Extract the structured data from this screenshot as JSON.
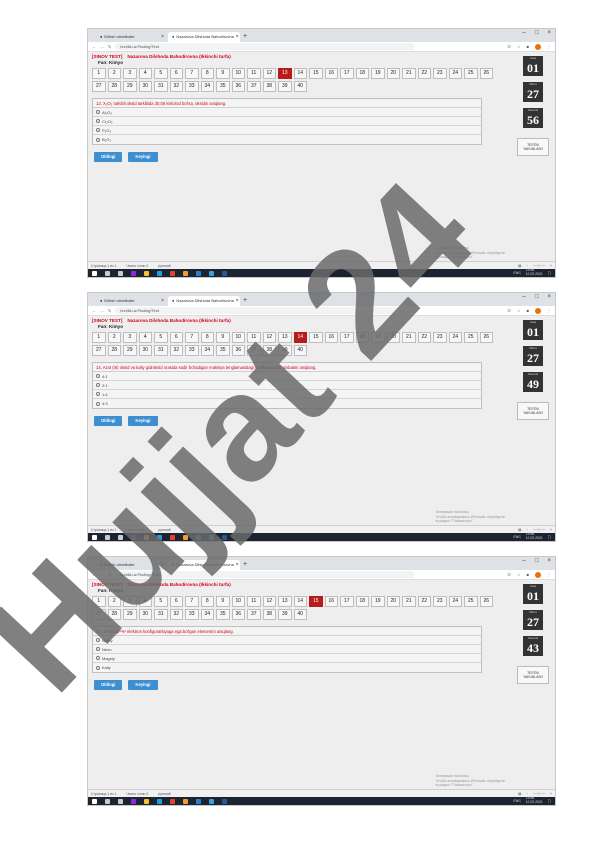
{
  "shots": [
    {
      "tab1": "Eritish viewfinder",
      "tab2": "Nazarova Dilshoda Bahodirovna",
      "url": "tezt48.uz/Testing/Test",
      "test_label": "[SINOV TEST]",
      "student": "Nazarova Dilshoda Bahodirovna (Ikkinchi turfa)",
      "fan": "Fan: Kimyo",
      "current": 13,
      "question": "13.   X₂O₃ tarkibli oksid tarkibida 30,06 kislorod bo'lsa, oksidni aniqlang.",
      "options": [
        "Al₂O₃",
        "Cr₂O₃",
        "P₂O₃",
        "B₂O₃"
      ],
      "timer": [
        "01",
        "27",
        "56"
      ]
    },
    {
      "tab1": "Eritish viewfinder",
      "tab2": "Nazarova Dilshoda Bahodirovna",
      "url": "tezt48.uz/Testing/Test",
      "test_label": "[SINOV TEST]",
      "student": "Nazarova Dilshoda Bahodirovna (Ikkinchi turfa)",
      "fan": "Fan: Kimyo",
      "current": 14,
      "question": "14.   Azot (III) oksid va kaliy gidroksid orasida sodir bo'ladigan reaksiya tenglamasidagi koeffitsiyentlar nisbatini aniqlang.",
      "options": [
        "4:1",
        "2:1",
        "1:4",
        "4:3"
      ],
      "timer": [
        "01",
        "27",
        "49"
      ]
    },
    {
      "tab1": "Eritish viewfinder",
      "tab2": "Nazarova Dilshoda Bahodirovna",
      "url": "tezt48.uz/Testing/Test",
      "test_label": "[SINOV TEST]",
      "student": "Nazarova Dilshoda Bahodirovna (Ikkinchi turfa)",
      "fan": "Fan: Kimyo",
      "current": 15,
      "question": "15.   1s²2s²2p⁶³s² elektron konfiguratsiyaga ega bo'lgan elementni aniqlang.",
      "options": [
        "Natriy",
        "Neon",
        "Magniy",
        "Kaliy"
      ],
      "timer": [
        "01",
        "27",
        "43"
      ]
    }
  ],
  "buttons": {
    "prev": "Oldingi",
    "next": "Keyingi"
  },
  "finish": "TESTNI YAKUNLASH",
  "timer_labels": [
    "Soat",
    "Minut",
    "Sekund"
  ],
  "activate": [
    "Активация Windows",
    "Чтобы активировать Windows, перейдите",
    "в раздел \"Параметры\"."
  ],
  "status": {
    "left": "Страница 1 из 1",
    "words": "Число слов: 0",
    "lang": "русский"
  },
  "clock": {
    "lang": "ENG",
    "time": "15:58",
    "date": "10.02.2021"
  },
  "watermark": "Hujjat 24",
  "colors": {
    "accent": "#b71c1c",
    "button": "#3d8fd1",
    "question": "#d0021b"
  }
}
